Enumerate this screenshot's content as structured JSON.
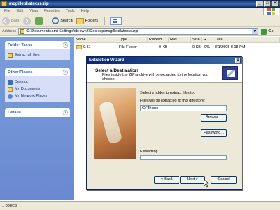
{
  "window": {
    "title": "mcgilletdlatexss.zip",
    "buttons": [
      "_",
      "□",
      "×"
    ]
  },
  "menu": [
    "File",
    "Edit",
    "View",
    "Favorites",
    "Tools",
    "Help"
  ],
  "toolbar": {
    "back": "Back",
    "search": "Search",
    "folders": "Folders"
  },
  "address": {
    "label": "Address",
    "value": "C:\\Documents and Settings\\ebrown6\\Desktop\\mcgilletdlatexss.zip",
    "go": "Go"
  },
  "left": {
    "folder_tasks": {
      "title": "Folder Tasks",
      "items": [
        "Extract all files"
      ]
    },
    "other_places": {
      "title": "Other Places",
      "items": [
        "Desktop",
        "My Documents",
        "My Network Places"
      ]
    },
    "details": {
      "title": "Details"
    }
  },
  "files": {
    "columns": [
      "Name",
      "Type",
      "Packed ...",
      "Has ...",
      "Size",
      "R...",
      "Date"
    ],
    "rows": [
      {
        "name": "0.61",
        "type": "File Folder",
        "packed": "0 KB",
        "has": "",
        "size": "0 KB",
        "ratio": "0%",
        "date": "3/1/2005 3:18 PM"
      }
    ]
  },
  "status": {
    "text": "1 objects"
  },
  "dialog": {
    "title": "Extraction Wizard",
    "close": "x",
    "heading": "Select a Destination",
    "subheading": "Files inside the ZIP archive will be extracted to the location you choose.",
    "instruction": "Select a folder to extract files to.",
    "field_label": "Files will be extracted to this directory:",
    "field_value": "C:\\Thesis",
    "browse": "Browse...",
    "password": "Password...",
    "extracting": "Extracting...",
    "progress": 0.0,
    "back": "< Back",
    "next": "Next >",
    "cancel": "Cancel"
  }
}
